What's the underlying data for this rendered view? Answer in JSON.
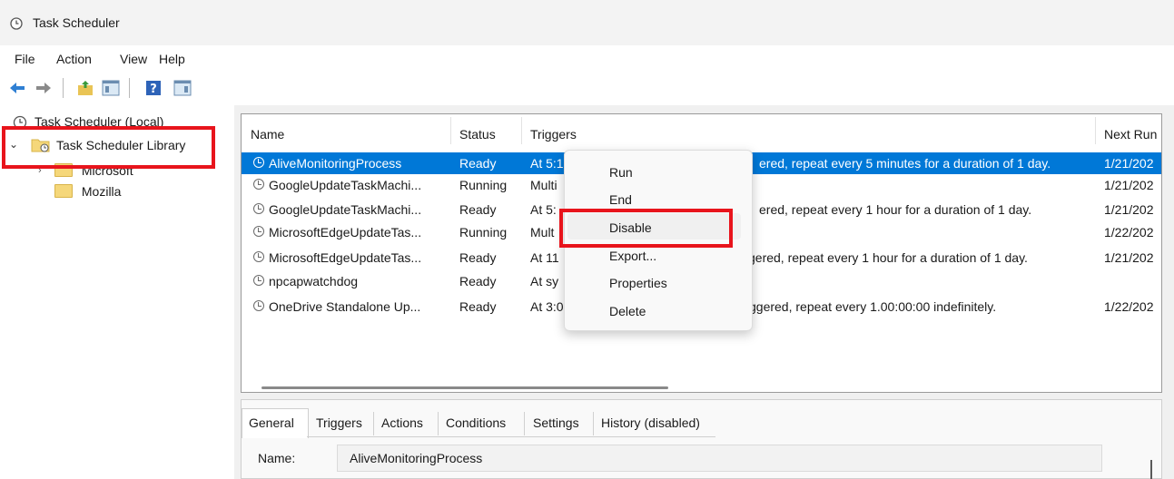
{
  "window": {
    "title": "Task Scheduler"
  },
  "menu": {
    "items": [
      "File",
      "Action",
      "View",
      "Help"
    ]
  },
  "toolbar": {
    "icons": [
      "back-arrow-icon",
      "forward-arrow-icon",
      "folder-up-icon",
      "show-hide-console-tree-icon",
      "help-icon",
      "show-hide-action-pane-icon"
    ]
  },
  "tree": {
    "root": "Task Scheduler (Local)",
    "library": "Task Scheduler Library",
    "children": [
      "Microsoft",
      "Mozilla"
    ]
  },
  "task_list": {
    "columns": [
      "Name",
      "Status",
      "Triggers",
      "Next Run"
    ],
    "rows": [
      {
        "name": "AliveMonitoringProcess",
        "status": "Ready",
        "trigger_start": "At 5:1",
        "trigger_end": "ered, repeat every 5 minutes for a duration of 1 day.",
        "next_run": "1/21/202",
        "selected": true
      },
      {
        "name": "GoogleUpdateTaskMachi...",
        "status": "Running",
        "trigger_start": "Multi",
        "trigger_end": "",
        "next_run": "1/21/202"
      },
      {
        "name": "GoogleUpdateTaskMachi...",
        "status": "Ready",
        "trigger_start": "At 5:",
        "trigger_end": "ered, repeat every 1 hour for a duration of 1 day.",
        "next_run": "1/21/202"
      },
      {
        "name": "MicrosoftEdgeUpdateTas...",
        "status": "Running",
        "trigger_start": "Mult",
        "trigger_end": "",
        "next_run": "1/22/202"
      },
      {
        "name": "MicrosoftEdgeUpdateTas...",
        "status": "Ready",
        "trigger_start": "At 11",
        "trigger_end": "gered, repeat every 1 hour for a duration of 1 day.",
        "next_run": "1/21/202"
      },
      {
        "name": "npcapwatchdog",
        "status": "Ready",
        "trigger_start": "At sy",
        "trigger_end": "",
        "next_run": ""
      },
      {
        "name": "OneDrive Standalone Up...",
        "status": "Ready",
        "trigger_start": "At 3:0",
        "trigger_end": "ggered, repeat every 1.00:00:00 indefinitely.",
        "next_run": "1/22/202"
      }
    ]
  },
  "context_menu": {
    "items": [
      "Run",
      "End",
      "Disable",
      "Export...",
      "Properties",
      "Delete"
    ],
    "highlighted": "Disable"
  },
  "details": {
    "tabs": [
      "General",
      "Triggers",
      "Actions",
      "Conditions",
      "Settings",
      "History (disabled)"
    ],
    "active_tab": "General",
    "name_label": "Name:",
    "name_value": "AliveMonitoringProcess"
  },
  "colors": {
    "selection": "#0078d7",
    "annotation_red": "#e8141c"
  }
}
